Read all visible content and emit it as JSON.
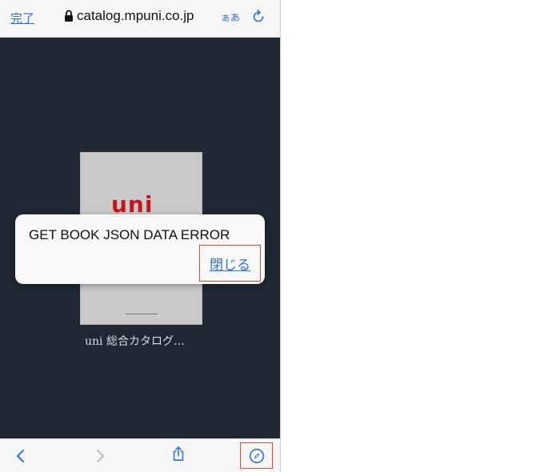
{
  "browser": {
    "done_label": "完了",
    "url": "catalog.mpuni.co.jp",
    "text_size_label": "ぁあ",
    "icons": {
      "lock": "lock-icon",
      "reload": "reload-icon",
      "back": "back-chevron-icon",
      "forward": "forward-chevron-icon",
      "share": "share-icon",
      "safari": "compass-icon"
    }
  },
  "book": {
    "cover_brand": "uni",
    "title": "uni 総合カタログ…"
  },
  "dialog": {
    "message": "GET BOOK JSON DATA ERROR",
    "close_label": "閉じる"
  },
  "colors": {
    "background": "#1f2833",
    "accent": "#2f6fe0",
    "brand_red": "#c4161c",
    "highlight": "#e24a2b"
  }
}
